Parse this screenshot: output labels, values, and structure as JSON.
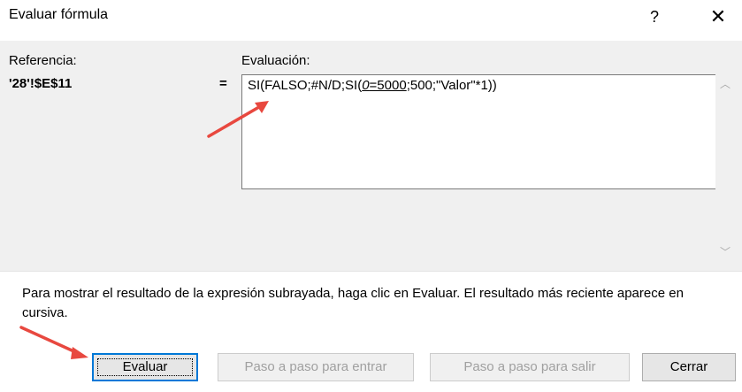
{
  "window": {
    "title": "Evaluar fórmula",
    "help_glyph": "?",
    "close_glyph": "✕"
  },
  "reference": {
    "label": "Referencia:",
    "value": "'28'!$E$11",
    "equals": "="
  },
  "evaluation": {
    "label": "Evaluación:",
    "formula_prefix": "SI(FALSO;#N/D;SI(",
    "formula_italic": "0",
    "formula_underlined_rest": "=5000",
    "formula_suffix": ";500;\"Valor\"*1))"
  },
  "scrollbar": {
    "up_glyph": "︿",
    "down_glyph": "﹀"
  },
  "description": "Para mostrar el resultado de la expresión subrayada, haga clic en Evaluar. El resultado más reciente aparece en cursiva.",
  "buttons": {
    "evaluate": "Evaluar",
    "step_in": "Paso a paso para entrar",
    "step_out": "Paso a paso para salir",
    "close": "Cerrar"
  },
  "colors": {
    "annotation_arrow": "#e8483f",
    "focus_border": "#0078d7"
  }
}
